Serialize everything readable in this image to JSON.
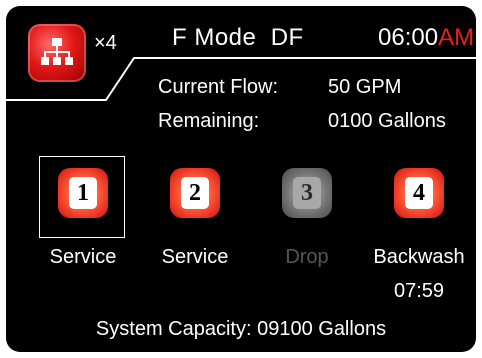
{
  "header": {
    "system_icon": "network-tree-icon",
    "multiplier": "×4",
    "mode_text": "F Mode  DF",
    "time": "06:00",
    "ampm": "AM"
  },
  "status": {
    "flow_label": "Current Flow:",
    "flow_value": "50 GPM",
    "remaining_label": "Remaining:",
    "remaining_value": "0100 Gallons"
  },
  "tanks": [
    {
      "number": "1",
      "state": "Service",
      "selected": true,
      "active": true
    },
    {
      "number": "2",
      "state": "Service",
      "selected": false,
      "active": true
    },
    {
      "number": "3",
      "state": "Drop",
      "selected": false,
      "active": false
    },
    {
      "number": "4",
      "state": "Backwash",
      "timer": "07:59",
      "selected": false,
      "active": true
    }
  ],
  "footer": {
    "capacity_text": "System Capacity: 09100 Gallons"
  },
  "colors": {
    "background": "#000000",
    "accent_red": "#e31818",
    "ampm_red": "#e8201c",
    "inactive_gray": "#777777"
  }
}
